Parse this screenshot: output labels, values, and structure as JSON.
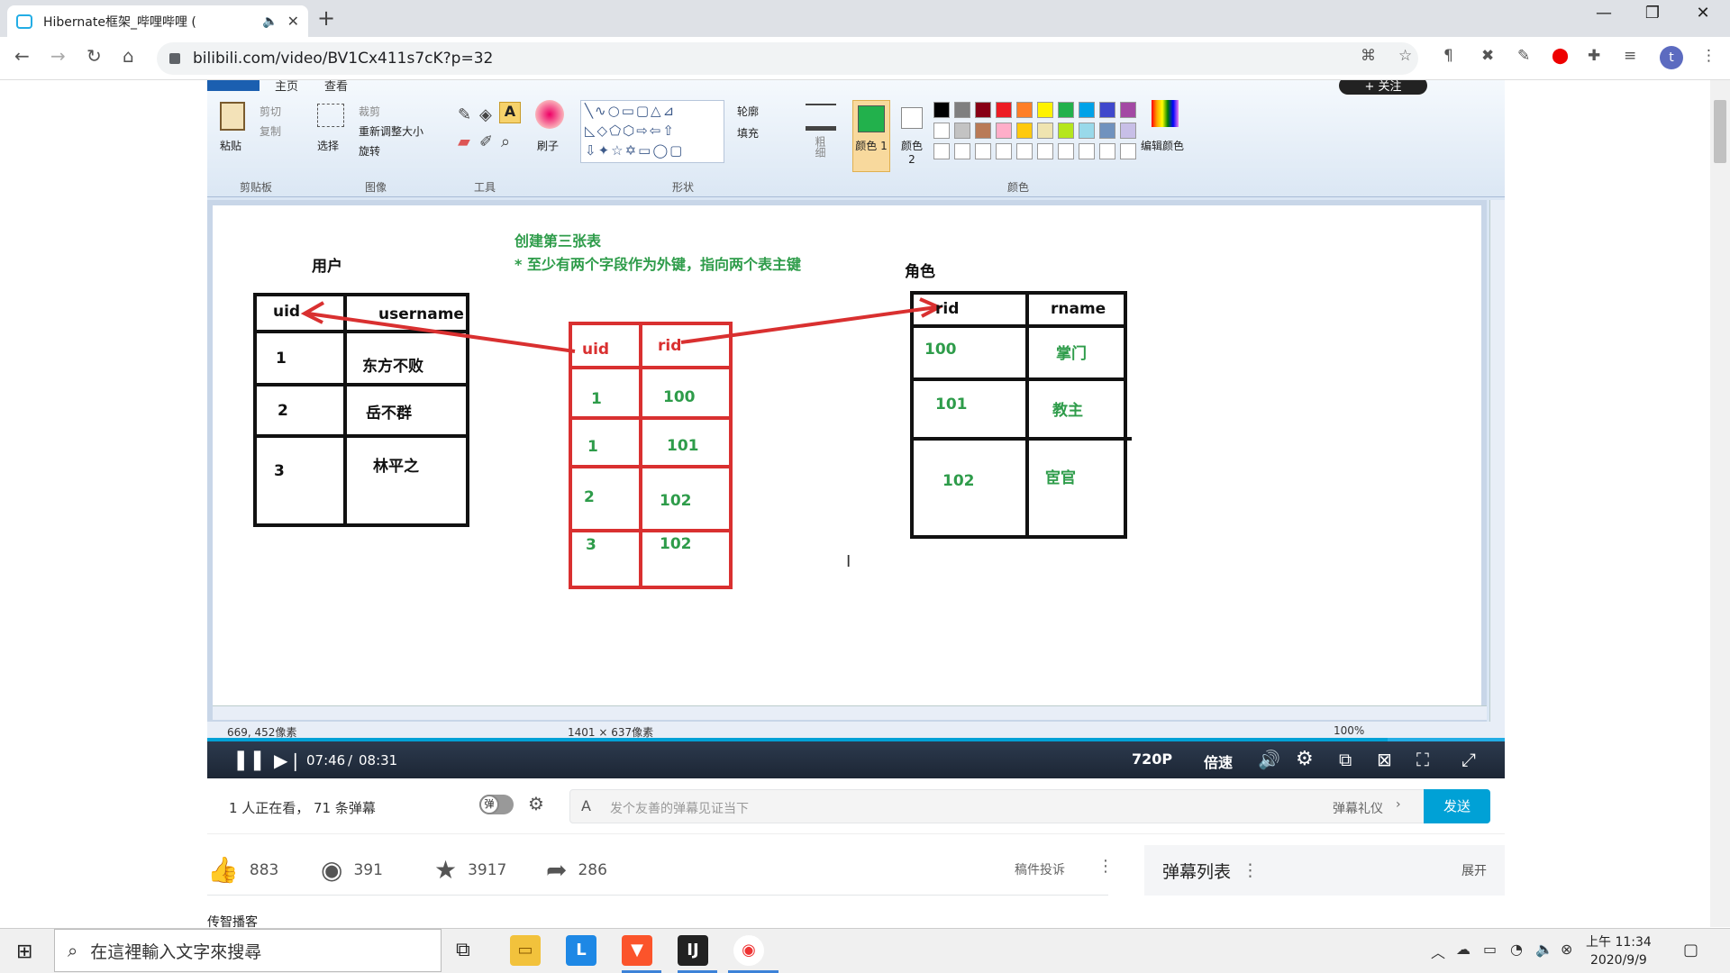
{
  "browser": {
    "tab_title": "Hibernate框架_哔哩哔哩 (",
    "url": "bilibili.com/video/BV1Cx411s7cK?p=32",
    "profile_initial": "t"
  },
  "paint": {
    "tabs": [
      "主页",
      "查看"
    ],
    "follow_button": "+ 关注",
    "clipboard": {
      "paste": "粘贴",
      "cut": "剪切",
      "copy": "复制",
      "group": "剪贴板"
    },
    "image": {
      "select": "选择",
      "crop": "裁剪",
      "resize": "重新调整大小",
      "rotate": "旋转",
      "group": "图像"
    },
    "tools_group": "工具",
    "brush": "刷子",
    "shapes": {
      "outline": "轮廓",
      "fill": "填充",
      "group": "形状"
    },
    "size": "粗细",
    "color1": "颜色 1",
    "color2": "颜色 2",
    "edit_colors": "编辑颜色",
    "colors_group": "颜色",
    "palette_row1": [
      "#000000",
      "#7f7f7f",
      "#880015",
      "#ed1c24",
      "#ff7f27",
      "#fff200",
      "#22b14c",
      "#00a2e8",
      "#3f48cc",
      "#a349a4"
    ],
    "palette_row2": [
      "#ffffff",
      "#c3c3c3",
      "#b97a57",
      "#ffaec9",
      "#ffc90e",
      "#efe4b0",
      "#b5e61d",
      "#99d9ea",
      "#7092be",
      "#c8bfe7"
    ],
    "status": {
      "cursor": "669, 452像素",
      "size": "1401 × 637像素",
      "zoom": "100%"
    }
  },
  "diagram": {
    "note_title": "创建第三张表",
    "note_body": "* 至少有两个字段作为外键，指向两个表主键",
    "user_label": "用户",
    "role_label": "角色",
    "user_table": {
      "headers": [
        "uid",
        "username"
      ],
      "rows": [
        [
          "1",
          "东方不败"
        ],
        [
          "2",
          "岳不群"
        ],
        [
          "3",
          "林平之"
        ]
      ]
    },
    "link_table": {
      "headers": [
        "uid",
        "rid"
      ],
      "rows": [
        [
          "1",
          "100"
        ],
        [
          "1",
          "101"
        ],
        [
          "2",
          "102"
        ],
        [
          "3",
          "102"
        ]
      ]
    },
    "role_table": {
      "headers": [
        "rid",
        "rname"
      ],
      "rows": [
        [
          "100",
          "掌门"
        ],
        [
          "101",
          "教主"
        ],
        [
          "102",
          "宦官"
        ]
      ]
    }
  },
  "player": {
    "time_current": "07:46",
    "time_total": "08:31",
    "quality": "720P",
    "speed": "倍速"
  },
  "danmaku": {
    "viewers": "1 人正在看，",
    "count": "71 条弹幕",
    "toggle": "弹",
    "placeholder": "发个友善的弹幕见证当下",
    "etiquette": "弹幕礼仪",
    "send": "发送"
  },
  "stats": {
    "like": "883",
    "coin": "391",
    "fav": "3917",
    "share": "286",
    "report": "稿件投诉"
  },
  "danmaku_list": {
    "title": "弹幕列表",
    "expand": "展开"
  },
  "uploader_partial": "传智播客",
  "taskbar": {
    "search_placeholder": "在這裡輸入文字來搜尋",
    "time": "上午 11:34",
    "date": "2020/9/9"
  }
}
